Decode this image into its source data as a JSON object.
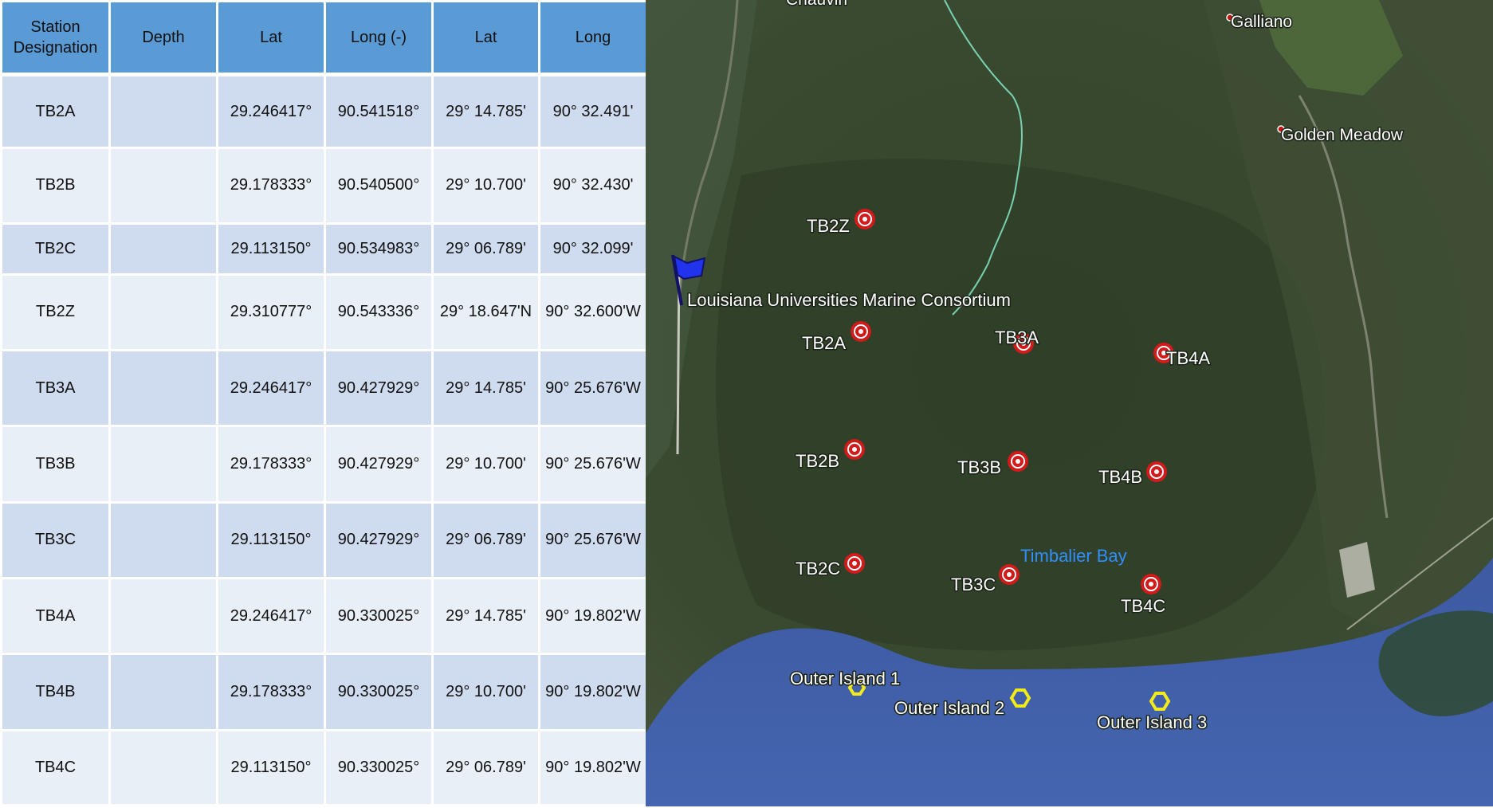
{
  "table": {
    "headers": [
      "Station Designation",
      "Depth",
      "Lat",
      "Long (-)",
      "Lat",
      "Long"
    ],
    "rows": [
      [
        "TB2A",
        "",
        "29.246417°",
        "90.541518°",
        "29° 14.785'",
        "90° 32.491'"
      ],
      [
        "TB2B",
        "",
        "29.178333°",
        "90.540500°",
        "29° 10.700'",
        "90° 32.430'"
      ],
      [
        "TB2C",
        "",
        "29.113150°",
        "90.534983°",
        "29° 06.789'",
        "90° 32.099'"
      ],
      [
        "TB2Z",
        "",
        "29.310777°",
        "90.543336°",
        "29° 18.647'N",
        "90° 32.600'W"
      ],
      [
        "TB3A",
        "",
        "29.246417°",
        "90.427929°",
        "29° 14.785'",
        "90° 25.676'W"
      ],
      [
        "TB3B",
        "",
        "29.178333°",
        "90.427929°",
        "29° 10.700'",
        "90° 25.676'W"
      ],
      [
        "TB3C",
        "",
        "29.113150°",
        "90.427929°",
        "29° 06.789'",
        "90° 25.676'W"
      ],
      [
        "TB4A",
        "",
        "29.246417°",
        "90.330025°",
        "29° 14.785'",
        "90° 19.802'W"
      ],
      [
        "TB4B",
        "",
        "29.178333°",
        "90.330025°",
        "29° 10.700'",
        "90° 19.802'W"
      ],
      [
        "TB4C",
        "",
        "29.113150°",
        "90.330025°",
        "29° 06.789'",
        "90° 19.802'W"
      ]
    ]
  },
  "map": {
    "places": {
      "galliano": "Galliano",
      "golden_meadow": "Golden Meadow",
      "lumcon": "Louisiana Universities Marine Consortium",
      "timbalier_bay": "Timbalier Bay",
      "chauvin": "Chauvin"
    },
    "stations": {
      "tb2z": "TB2Z",
      "tb2a": "TB2A",
      "tb2b": "TB2B",
      "tb2c": "TB2C",
      "tb3a": "TB3A",
      "tb3b": "TB3B",
      "tb3c": "TB3C",
      "tb4a": "TB4A",
      "tb4b": "TB4B",
      "tb4c": "TB4C"
    },
    "outer_islands": {
      "oi1": "Outer Island 1",
      "oi2": "Outer Island 2",
      "oi3": "Outer Island 3"
    },
    "colors": {
      "station_marker": "#d11a1a",
      "outer_island_marker": "#f2ea1a",
      "flag": "#2233ee",
      "water": "#3e5fa8",
      "marsh": "#3a4a30",
      "bay_label": "#2f8fff"
    },
    "icons": {
      "station": "red-target-icon",
      "outer_island": "yellow-hexagon-icon",
      "lumcon": "blue-flag-icon"
    }
  }
}
